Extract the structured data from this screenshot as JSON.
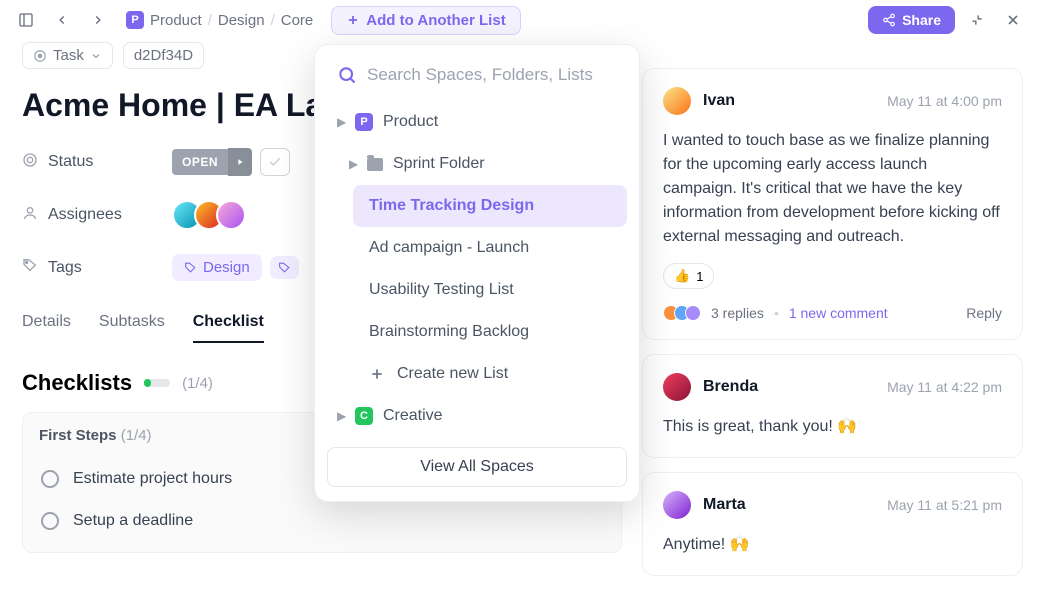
{
  "header": {
    "breadcrumbs": {
      "space_badge": "P",
      "space": "Product",
      "folder": "Design",
      "list": "Core"
    },
    "add_to_list_label": "Add to Another List",
    "share_label": "Share"
  },
  "task": {
    "type_label": "Task",
    "id": "d2Df34D",
    "title": "Acme Home | EA La",
    "status_label": "Status",
    "status_value": "OPEN",
    "assignees_label": "Assignees",
    "tags_label": "Tags",
    "tag1": "Design"
  },
  "tabs": {
    "details": "Details",
    "subtasks": "Subtasks",
    "checklist": "Checklist"
  },
  "checklists": {
    "heading": "Checklists",
    "progress": "(1/4)",
    "group": {
      "name": "First Steps",
      "frac": "(1/4)"
    },
    "items": {
      "i1": "Estimate project hours",
      "i2": "Setup a deadline"
    }
  },
  "popover": {
    "search_placeholder": "Search Spaces, Folders, Lists",
    "space_p_badge": "P",
    "space_p": "Product",
    "folder": "Sprint Folder",
    "list1": "Time Tracking Design",
    "list2": "Ad campaign - Launch",
    "list3": "Usability Testing List",
    "list4": "Brainstorming Backlog",
    "create_list": "Create new List",
    "space_c_badge": "C",
    "space_c": "Creative",
    "view_all": "View All Spaces"
  },
  "comments": {
    "c1": {
      "author": "Ivan",
      "time": "May 11 at 4:00 pm",
      "body": "I wanted to touch base as we finalize planning for the upcoming early access launch campaign. It's critical that we have the key information from development before kicking off external messaging and outreach.",
      "reaction_emoji": "👍",
      "reaction_count": "1",
      "replies": "3 replies",
      "new_comment": "1 new comment",
      "reply": "Reply"
    },
    "c2": {
      "author": "Brenda",
      "time": "May 11 at 4:22 pm",
      "body": "This is great, thank you! 🙌"
    },
    "c3": {
      "author": "Marta",
      "time": "May 11 at 5:21 pm",
      "body": "Anytime! 🙌"
    }
  }
}
